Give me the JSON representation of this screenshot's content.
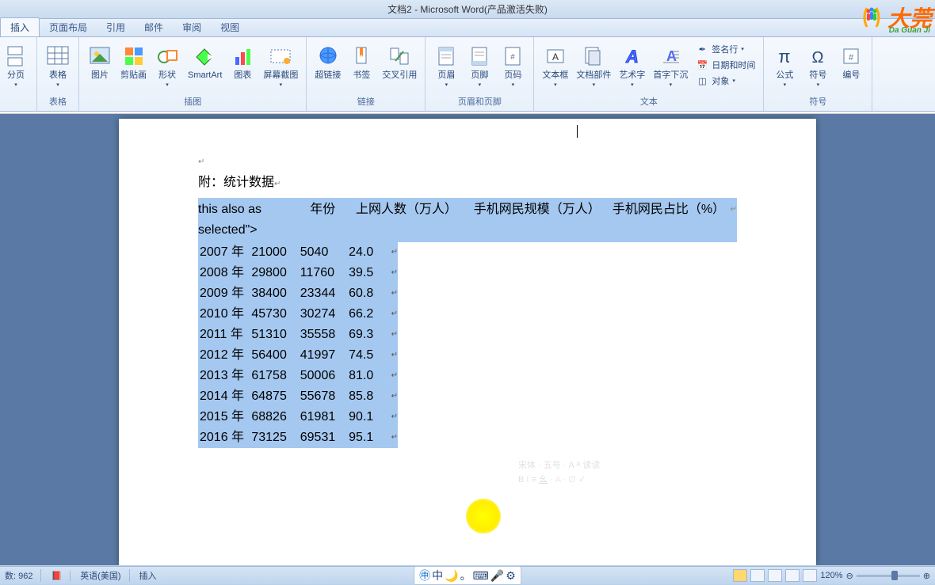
{
  "window": {
    "title": "文档2 - Microsoft Word(产品激活失败)"
  },
  "tabs": [
    "插入",
    "页面布局",
    "引用",
    "邮件",
    "审阅",
    "视图"
  ],
  "active_tab": 0,
  "ribbon_groups": {
    "pages": {
      "label": "",
      "items": [
        {
          "label": "分页"
        }
      ]
    },
    "tables": {
      "label": "表格",
      "items": [
        {
          "label": "表格"
        }
      ]
    },
    "illustrations": {
      "label": "插图",
      "items": [
        {
          "label": "图片"
        },
        {
          "label": "剪贴画"
        },
        {
          "label": "形状"
        },
        {
          "label": "SmartArt"
        },
        {
          "label": "图表"
        },
        {
          "label": "屏幕截图"
        }
      ]
    },
    "links": {
      "label": "链接",
      "items": [
        {
          "label": "超链接"
        },
        {
          "label": "书签"
        },
        {
          "label": "交叉引用"
        }
      ]
    },
    "header_footer": {
      "label": "页眉和页脚",
      "items": [
        {
          "label": "页眉"
        },
        {
          "label": "页脚"
        },
        {
          "label": "页码"
        }
      ]
    },
    "text": {
      "label": "文本",
      "big": [
        {
          "label": "文本框"
        },
        {
          "label": "文档部件"
        },
        {
          "label": "艺术字"
        },
        {
          "label": "首字下沉"
        }
      ],
      "small": [
        {
          "label": "签名行"
        },
        {
          "label": "日期和时间"
        },
        {
          "label": "对象"
        }
      ]
    },
    "symbols": {
      "label": "符号",
      "items": [
        {
          "label": "公式"
        },
        {
          "label": "符号"
        },
        {
          "label": "编号"
        }
      ]
    }
  },
  "document": {
    "caption": "附：统计数据",
    "headers": [
      "年份",
      "上网人数（万人）",
      "手机网民规模（万人）",
      "手机网民占比（%）"
    ],
    "rows": [
      {
        "year": "2007 年",
        "v1": "21000",
        "v2": "5040",
        "v3": "24.0"
      },
      {
        "year": "2008 年",
        "v1": "29800",
        "v2": "11760",
        "v3": "39.5"
      },
      {
        "year": "2009 年",
        "v1": "38400",
        "v2": "23344",
        "v3": "60.8"
      },
      {
        "year": "2010 年",
        "v1": "45730",
        "v2": "30274",
        "v3": "66.2"
      },
      {
        "year": "2011 年",
        "v1": "51310",
        "v2": "35558",
        "v3": "69.3"
      },
      {
        "year": "2012 年",
        "v1": "56400",
        "v2": "41997",
        "v3": "74.5"
      },
      {
        "year": "2013 年",
        "v1": "61758",
        "v2": "50006",
        "v3": "81.0"
      },
      {
        "year": "2014 年",
        "v1": "64875",
        "v2": "55678",
        "v3": "85.8"
      },
      {
        "year": "2015 年",
        "v1": "68826",
        "v2": "61981",
        "v3": "90.1"
      },
      {
        "year": "2016 年",
        "v1": "73125",
        "v2": "69531",
        "v3": "95.1"
      }
    ]
  },
  "status": {
    "word_count_label": "数:",
    "word_count": "962",
    "language": "英语(美国)",
    "mode": "插入",
    "zoom": "120%"
  },
  "logo": {
    "text": "大莞",
    "sub": "Da Guan Ji"
  },
  "chart_data": {
    "type": "table",
    "title": "附：统计数据",
    "columns": [
      "年份",
      "上网人数（万人）",
      "手机网民规模（万人）",
      "手机网民占比（%）"
    ],
    "rows": [
      [
        "2007",
        21000,
        5040,
        24.0
      ],
      [
        "2008",
        29800,
        11760,
        39.5
      ],
      [
        "2009",
        38400,
        23344,
        60.8
      ],
      [
        "2010",
        45730,
        30274,
        66.2
      ],
      [
        "2011",
        51310,
        35558,
        69.3
      ],
      [
        "2012",
        56400,
        41997,
        74.5
      ],
      [
        "2013",
        61758,
        50006,
        81.0
      ],
      [
        "2014",
        64875,
        55678,
        85.8
      ],
      [
        "2015",
        68826,
        61981,
        90.1
      ],
      [
        "2016",
        73125,
        69531,
        95.1
      ]
    ]
  }
}
